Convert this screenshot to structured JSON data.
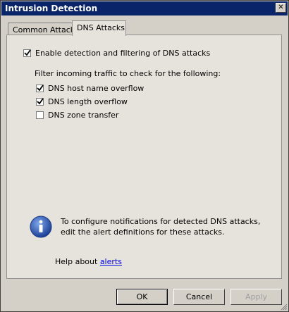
{
  "window": {
    "title": "Intrusion Detection"
  },
  "tabs": [
    {
      "label": "Common Attacks",
      "selected": false
    },
    {
      "label": "DNS Attacks",
      "selected": true
    }
  ],
  "dns": {
    "enable": {
      "label": "Enable detection and filtering of DNS attacks",
      "checked": true
    },
    "filter_heading": "Filter incoming traffic to check for the following:",
    "options": [
      {
        "label": "DNS host name overflow",
        "checked": true
      },
      {
        "label": "DNS length overflow",
        "checked": true
      },
      {
        "label": "DNS zone transfer",
        "checked": false
      }
    ],
    "info_text": "To configure notifications for detected DNS attacks, edit the alert definitions for these attacks.",
    "help_prefix": "Help about ",
    "help_link": "alerts"
  },
  "buttons": {
    "ok": "OK",
    "cancel": "Cancel",
    "apply": "Apply",
    "apply_enabled": false
  },
  "colors": {
    "title_bar": "#0a246a",
    "link": "#0000ee",
    "info_icon": "#2f5fb3"
  }
}
